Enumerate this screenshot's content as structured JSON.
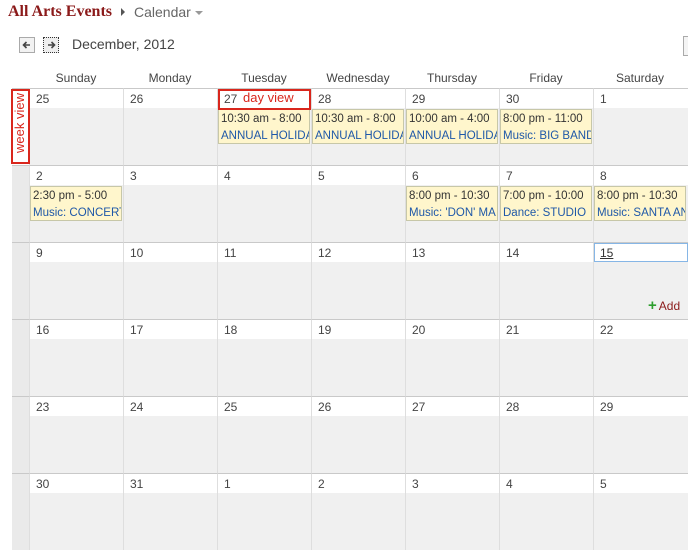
{
  "breadcrumb": {
    "site": "All Arts Events",
    "list": "Calendar"
  },
  "nav": {
    "month_title": "December, 2012"
  },
  "weekdays": [
    "Sunday",
    "Monday",
    "Tuesday",
    "Wednesday",
    "Thursday",
    "Friday",
    "Saturday"
  ],
  "weeks": [
    [
      "25",
      "26",
      "27",
      "28",
      "29",
      "30",
      "1"
    ],
    [
      "2",
      "3",
      "4",
      "5",
      "6",
      "7",
      "8"
    ],
    [
      "9",
      "10",
      "11",
      "12",
      "13",
      "14",
      "15"
    ],
    [
      "16",
      "17",
      "18",
      "19",
      "20",
      "21",
      "22"
    ],
    [
      "23",
      "24",
      "25",
      "26",
      "27",
      "28",
      "29"
    ],
    [
      "30",
      "31",
      "1",
      "2",
      "3",
      "4",
      "5"
    ]
  ],
  "events": [
    {
      "week": 0,
      "day": 2,
      "time": "10:30 am - 8:00",
      "title": "ANNUAL HOLIDAY"
    },
    {
      "week": 0,
      "day": 3,
      "time": "10:30 am - 8:00",
      "title": "ANNUAL HOLIDAY"
    },
    {
      "week": 0,
      "day": 4,
      "time": "10:00 am - 4:00",
      "title": "ANNUAL HOLIDAY"
    },
    {
      "week": 0,
      "day": 5,
      "time": "8:00 pm - 11:00",
      "title": "Music: BIG BAND"
    },
    {
      "week": 1,
      "day": 0,
      "time": "2:30 pm - 5:00",
      "title": "Music: CONCERT"
    },
    {
      "week": 1,
      "day": 4,
      "time": "8:00 pm - 10:30",
      "title": "Music: 'DON' MA"
    },
    {
      "week": 1,
      "day": 5,
      "time": "7:00 pm - 10:00",
      "title": "Dance: STUDIO"
    },
    {
      "week": 1,
      "day": 6,
      "time": "8:00 pm - 10:30",
      "title": "Music: SANTA AND"
    }
  ],
  "today": {
    "week": 2,
    "day": 6
  },
  "annotations": {
    "day_view": "day view",
    "week_view": "week view"
  },
  "add_label": "Add",
  "colors": {
    "site_title": "#8b1a1a",
    "annotation": "#d9261c",
    "event_bg": "#fff6cc",
    "event_title": "#1f58a8"
  }
}
